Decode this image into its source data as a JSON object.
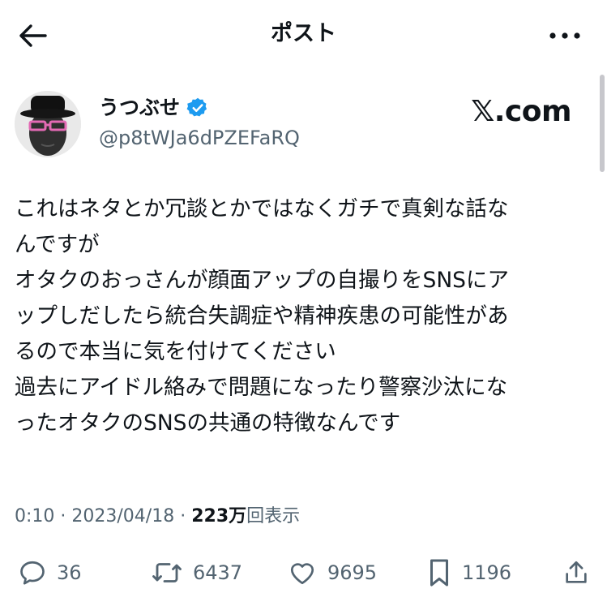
{
  "header": {
    "title": "ポスト"
  },
  "author": {
    "display_name": "うつぶせ",
    "handle": "@p8tWJa6dPZEFaRQ",
    "verified": true
  },
  "source_logo": "𝕏.com",
  "tweet": {
    "lines": [
      "これはネタとか冗談とかではなくガチで真剣な話な",
      "んですが",
      "オタクのおっさんが顔面アップの自撮りをSNSにア",
      "ップしだしたら統合失調症や精神疾患の可能性があ",
      "るので本当に気を付けてください",
      "過去にアイドル絡みで問題になったり警察沙汰にな",
      "ったオタクのSNSの共通の特徴なんです"
    ]
  },
  "meta": {
    "time": "0:10",
    "separator": "·",
    "date": "2023/04/18",
    "views_count": "223万",
    "views_label": "回表示"
  },
  "actions": {
    "replies": "36",
    "reposts": "6437",
    "likes": "9695",
    "bookmarks": "1196"
  },
  "colors": {
    "text": "#0f1419",
    "secondary": "#536471",
    "verified": "#1d9bf0"
  },
  "icons": {
    "back": "arrow-left-icon",
    "more": "more-horizontal-icon",
    "verified": "verified-badge-icon",
    "reply": "reply-icon",
    "repost": "repost-icon",
    "like": "heart-icon",
    "bookmark": "bookmark-icon",
    "share": "share-icon"
  }
}
